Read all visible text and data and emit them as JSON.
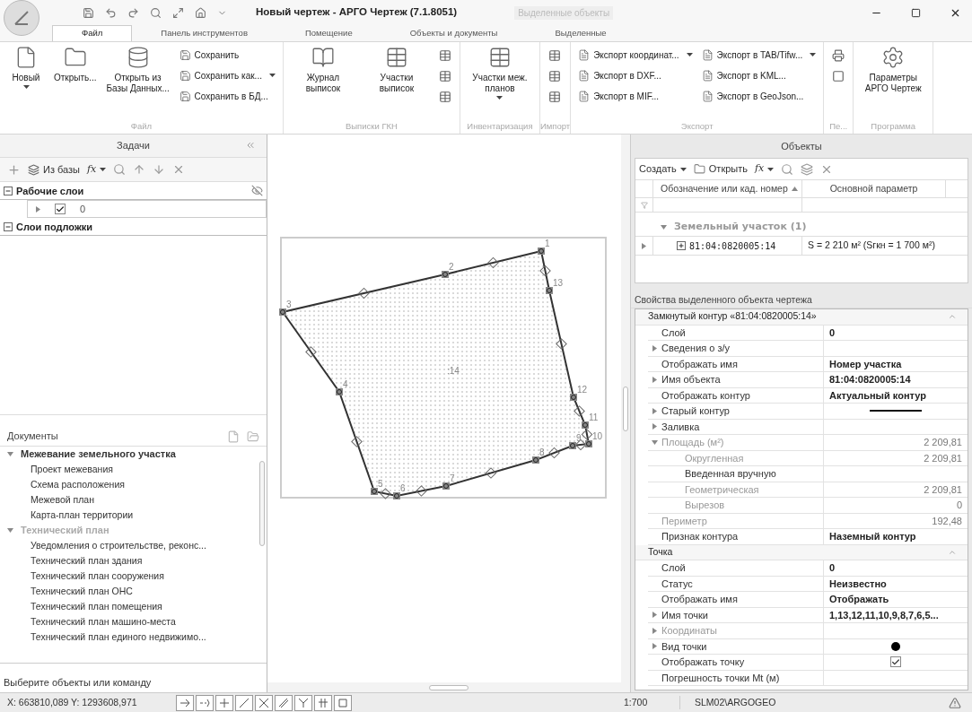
{
  "window": {
    "title": "Новый чертеж - АРГО Чертеж (7.1.8051)",
    "context_title": "Выделенные объекты"
  },
  "tabs": [
    {
      "label": "Файл",
      "selected": true
    },
    {
      "label": "Панель инструментов",
      "selected": false
    },
    {
      "label": "Помещение",
      "selected": false
    },
    {
      "label": "Объекты и документы",
      "selected": false
    },
    {
      "label": "Выделенные",
      "selected": false
    }
  ],
  "ribbon": [
    {
      "label": "Файл",
      "items": [
        {
          "kind": "large",
          "label": "Новый",
          "dropdown": true
        },
        {
          "kind": "large",
          "label": "Открыть...",
          "dropdown": false
        },
        {
          "kind": "large",
          "label": "Открыть из Базы Данных...",
          "dropdown": false
        },
        {
          "kind": "stack",
          "entries": [
            {
              "label": "Сохранить",
              "dropdown": false
            },
            {
              "label": "Сохранить как...",
              "dropdown": true
            },
            {
              "label": "Сохранить в БД...",
              "dropdown": false
            }
          ]
        }
      ]
    },
    {
      "label": "Выписки ГКН",
      "items": [
        {
          "kind": "large",
          "label": "Журнал выписок",
          "dropdown": false
        },
        {
          "kind": "large",
          "label": "Участки выписок",
          "dropdown": false
        },
        {
          "kind": "icons"
        }
      ]
    },
    {
      "label": "Инвентаризация",
      "items": [
        {
          "kind": "large",
          "label": "Участки меж. планов",
          "dropdown": true
        }
      ]
    },
    {
      "label": "Импорт",
      "items": [
        {
          "kind": "icons"
        }
      ]
    },
    {
      "label": "Экспорт",
      "items": [
        {
          "kind": "stack",
          "entries": [
            {
              "label": "Экспорт координат...",
              "dropdown": true
            },
            {
              "label": "Экспорт в DXF...",
              "dropdown": false
            },
            {
              "label": "Экспорт в MIF...",
              "dropdown": false
            }
          ]
        },
        {
          "kind": "stack",
          "entries": [
            {
              "label": "Экспорт в TAB/Tifw...",
              "dropdown": true
            },
            {
              "label": "Экспорт в KML...",
              "dropdown": false
            },
            {
              "label": "Экспорт в GeoJson...",
              "dropdown": false
            }
          ]
        }
      ]
    },
    {
      "label": "Пе...",
      "items": [
        {
          "kind": "icons"
        }
      ]
    },
    {
      "label": "Программа",
      "items": [
        {
          "kind": "large",
          "label": "Параметры АРГО Чертеж",
          "dropdown": false
        }
      ]
    }
  ],
  "tasks": {
    "title": "Задачи",
    "toolbar": {
      "from_db": "Из базы",
      "function": "fx"
    },
    "groups": [
      {
        "label": "Рабочие слои",
        "expanded": true,
        "layers": [
          {
            "name": "0",
            "checked": true
          }
        ]
      },
      {
        "label": "Слои подложки",
        "expanded": true
      }
    ]
  },
  "documents": {
    "title": "Документы",
    "groups": [
      {
        "label": "Межевание земельного участка",
        "expanded": true,
        "disabled": false,
        "items": [
          "Проект межевания",
          "Схема расположения",
          "Межевой план",
          "Карта-план территории"
        ]
      },
      {
        "label": "Технический план",
        "expanded": true,
        "disabled": true,
        "items": [
          "Уведомления о строительстве, реконс...",
          "Технический план здания",
          "Технический план сооружения",
          "Технический план ОНС",
          "Технический план помещения",
          "Технический план машино-места",
          "Технический план единого недвижимо..."
        ]
      }
    ]
  },
  "command_prompt": "Выберите объекты или команду",
  "drawing": {
    "points": [
      "1",
      "2",
      "3",
      "4",
      "5",
      "6",
      "7",
      "8",
      "9",
      "10",
      "11",
      "12",
      "13"
    ],
    "parcel_label": ":14"
  },
  "objects": {
    "title": "Объекты",
    "toolbar": {
      "create": "Создать",
      "open": "Открыть",
      "function": "fx"
    },
    "columns": [
      {
        "label": "Обозначение или кад. номер",
        "sorted": true
      },
      {
        "label": "Основной параметр",
        "sorted": false
      }
    ],
    "group": {
      "label": "Земельный участок (1)",
      "expanded": true
    },
    "rows": [
      {
        "id": "81:04:0820005:14",
        "param": "S = 2 210 м² (Sгкн = 1 700 м²)",
        "selected": true,
        "expanded": false
      }
    ]
  },
  "properties": {
    "title": "Свойства выделенного объекта чертежа",
    "sections": [
      {
        "title": "Замкнутый контур «81:04:0820005:14»",
        "expanded": true,
        "rows": [
          {
            "label": "Слой",
            "kind": "bold",
            "value": "0",
            "disabled": false
          },
          {
            "label": "Сведения о з/у",
            "kind": "empty",
            "expanded": false,
            "disabled": false
          },
          {
            "label": "Отображать имя",
            "kind": "bold",
            "value": "Номер участка",
            "disabled": false
          },
          {
            "label": "Имя объекта",
            "kind": "bold",
            "value": "81:04:0820005:14",
            "expanded": false,
            "disabled": false
          },
          {
            "label": "Отображать контур",
            "kind": "bold",
            "value": "Актуальный контур",
            "disabled": false
          },
          {
            "label": "Старый контур",
            "kind": "line",
            "expanded": false,
            "disabled": false
          },
          {
            "label": "Заливка",
            "kind": "empty",
            "expanded": false,
            "disabled": false
          },
          {
            "label": "Площадь (м²)",
            "kind": "number",
            "value": "2 209,81",
            "expanded": true,
            "disabled": true,
            "children": [
              {
                "label": "Округленная",
                "kind": "number",
                "value": "2 209,81",
                "disabled": true
              },
              {
                "label": "Введенная вручную",
                "kind": "empty",
                "disabled": false
              },
              {
                "label": "Геометрическая",
                "kind": "number",
                "value": "2 209,81",
                "disabled": true
              },
              {
                "label": "Вырезов",
                "kind": "number",
                "value": "0",
                "disabled": true
              }
            ]
          },
          {
            "label": "Периметр",
            "kind": "number",
            "value": "192,48",
            "disabled": true
          },
          {
            "label": "Признак контура",
            "kind": "bold",
            "value": "Наземный контур",
            "disabled": false
          }
        ]
      },
      {
        "title": "Точка",
        "expanded": true,
        "rows": [
          {
            "label": "Слой",
            "kind": "bold",
            "value": "0",
            "disabled": false
          },
          {
            "label": "Статус",
            "kind": "bold",
            "value": "Неизвестно",
            "disabled": false
          },
          {
            "label": "Отображать имя",
            "kind": "bold",
            "value": "Отображать",
            "disabled": false
          },
          {
            "label": "Имя точки",
            "kind": "bold",
            "value": "1,13,12,11,10,9,8,7,6,5...",
            "expanded": false,
            "disabled": false
          },
          {
            "label": "Координаты",
            "kind": "empty",
            "expanded": false,
            "disabled": true
          },
          {
            "label": "Вид точки",
            "kind": "dot",
            "expanded": false,
            "disabled": false
          },
          {
            "label": "Отображать точку",
            "kind": "check",
            "checked": true,
            "disabled": false
          },
          {
            "label": "Погрешность точки Mt (м)",
            "kind": "empty",
            "disabled": false
          }
        ]
      }
    ]
  },
  "status_bar": {
    "coords": "X: 663810,089 Y: 1293608,971",
    "scale": "1:700",
    "user": "SLM02\\ARGOGEO"
  }
}
